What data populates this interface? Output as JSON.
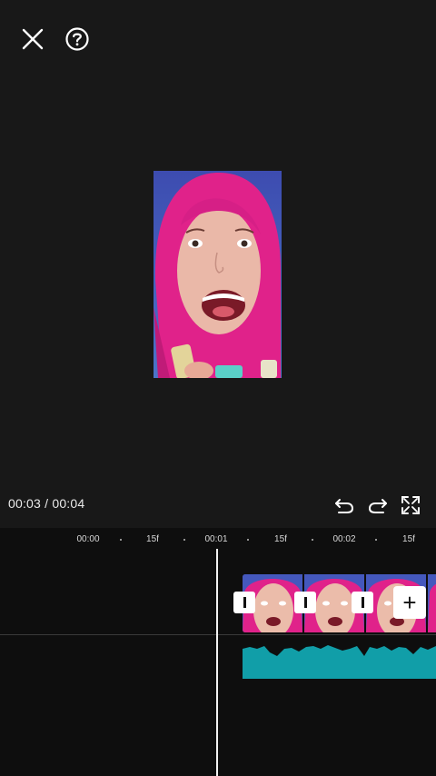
{
  "header": {
    "close_icon": "close-icon",
    "help_icon": "help-icon"
  },
  "player": {
    "current_time": "00:03",
    "separator": " / ",
    "total_time": "00:04",
    "undo_icon": "undo-icon",
    "redo_icon": "redo-icon",
    "fullscreen_icon": "fullscreen-icon"
  },
  "timeline": {
    "ruler": [
      "00:00",
      "15f",
      "00:01",
      "15f",
      "00:02",
      "15f"
    ],
    "add_label": "+",
    "colors": {
      "audio_wave": "#119ea8",
      "playhead": "#f2f2f2",
      "background": "#0e0e0e"
    }
  }
}
